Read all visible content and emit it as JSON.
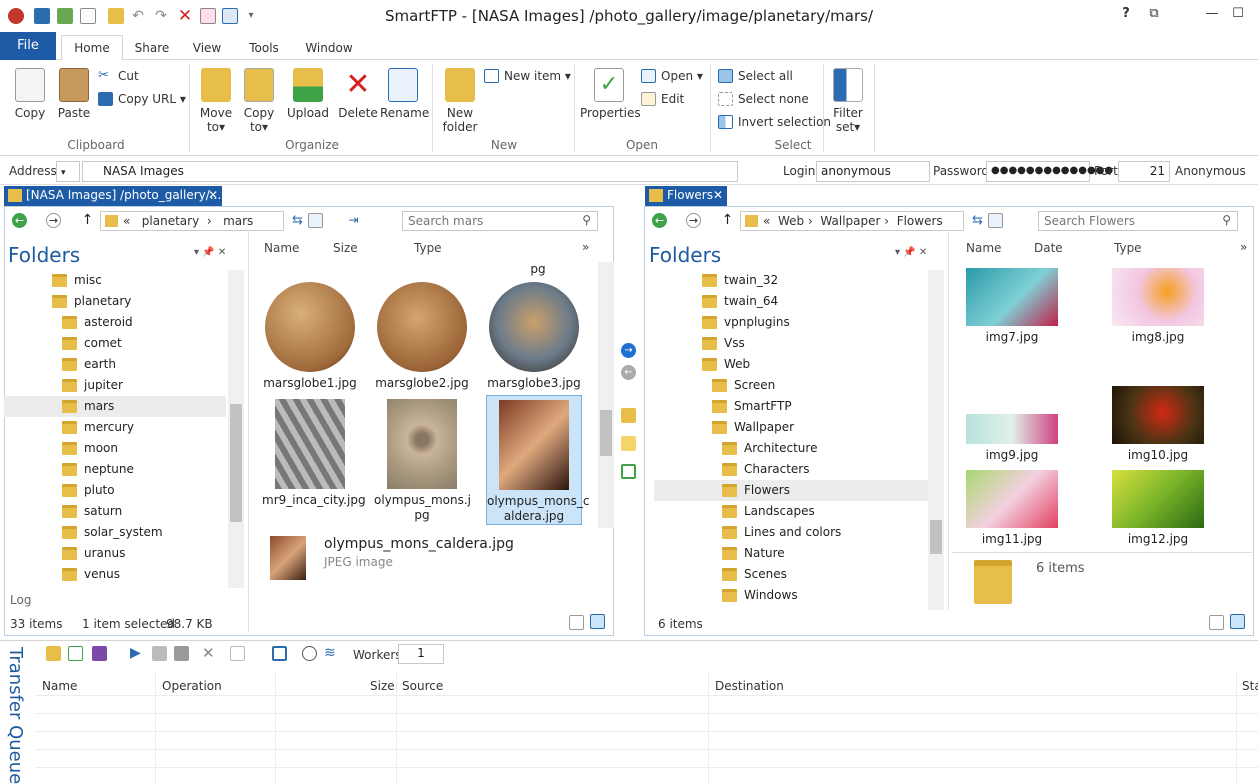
{
  "window": {
    "title": "SmartFTP - [NASA Images] /photo_gallery/image/planetary/mars/"
  },
  "colors": {
    "accent": "#1d5ba6",
    "folder": "#e8be4a",
    "selection": "#cce4f7"
  },
  "tabs": {
    "file": "File",
    "home": "Home",
    "share": "Share",
    "view": "View",
    "tools": "Tools",
    "window": "Window"
  },
  "ribbon": {
    "clipboard": {
      "copy": "Copy",
      "paste": "Paste",
      "cut": "Cut",
      "copy_url": "Copy URL",
      "label": "Clipboard"
    },
    "organize": {
      "move_to_1": "Move",
      "move_to_2": "to",
      "copy_to_1": "Copy",
      "copy_to_2": "to",
      "upload": "Upload",
      "delete": "Delete",
      "rename": "Rename",
      "label": "Organize"
    },
    "new": {
      "new_folder_1": "New",
      "new_folder_2": "folder",
      "new_item": "New item",
      "label": "New"
    },
    "open": {
      "properties": "Properties",
      "open": "Open",
      "edit": "Edit",
      "label": "Open"
    },
    "select": {
      "select_all": "Select all",
      "select_none": "Select none",
      "invert": "Invert selection",
      "label": "Select"
    },
    "filter": {
      "line1": "Filter",
      "line2": "set"
    }
  },
  "address": {
    "label": "Address",
    "value": "NASA Images",
    "login_label": "Login",
    "login": "anonymous",
    "password_label": "Password",
    "password": "●●●●●●●●●●●●●●",
    "port_label": "Port",
    "port": "21",
    "mode": "Anonymous"
  },
  "left": {
    "tab": "[NASA Images] /photo_gallery/...",
    "crumbs": {
      "sep": "«",
      "a": "planetary",
      "b": "mars"
    },
    "search_placeholder": "Search mars",
    "folders_title": "Folders",
    "tree": [
      "misc",
      "planetary",
      "asteroid",
      "comet",
      "earth",
      "jupiter",
      "mars",
      "mercury",
      "moon",
      "neptune",
      "pluto",
      "saturn",
      "solar_system",
      "uranus",
      "venus"
    ],
    "log": "Log",
    "cols": {
      "name": "Name",
      "size": "Size",
      "type": "Type"
    },
    "partial": "pg",
    "files": [
      {
        "l1": "marsglobe1.jpg",
        "l2": ""
      },
      {
        "l1": "marsglobe2.jpg",
        "l2": ""
      },
      {
        "l1": "marsglobe3.jpg",
        "l2": ""
      },
      {
        "l1": "mr9_inca_city.jpg",
        "l2": ""
      },
      {
        "l1": "olympus_mons.j",
        "l2": "pg"
      },
      {
        "l1": "olympus_mons_c",
        "l2": "aldera.jpg"
      }
    ],
    "preview": {
      "name": "olympus_mons_caldera.jpg",
      "type": "JPEG image"
    },
    "status": {
      "count": "33 items",
      "selected": "1 item selected",
      "size": "98.7 KB"
    }
  },
  "right": {
    "tab": "Flowers",
    "crumbs": {
      "sep": "«",
      "a": "Web",
      "b": "Wallpaper",
      "c": "Flowers"
    },
    "search_placeholder": "Search Flowers",
    "folders_title": "Folders",
    "tree": [
      "twain_32",
      "twain_64",
      "vpnplugins",
      "Vss",
      "Web",
      "Screen",
      "SmartFTP",
      "Wallpaper",
      "Architecture",
      "Characters",
      "Flowers",
      "Landscapes",
      "Lines and colors",
      "Nature",
      "Scenes",
      "Windows"
    ],
    "cols": {
      "name": "Name",
      "date": "Date",
      "type": "Type"
    },
    "files": [
      "img7.jpg",
      "img8.jpg",
      "img9.jpg",
      "img10.jpg",
      "img11.jpg",
      "img12.jpg"
    ],
    "preview_count": "6 items",
    "status": {
      "count": "6 items"
    }
  },
  "queue": {
    "title": "Transfer Queue",
    "workers_label": "Workers",
    "workers": "1",
    "cols": {
      "name": "Name",
      "operation": "Operation",
      "size": "Size",
      "source": "Source",
      "destination": "Destination",
      "status": "Sta"
    }
  }
}
